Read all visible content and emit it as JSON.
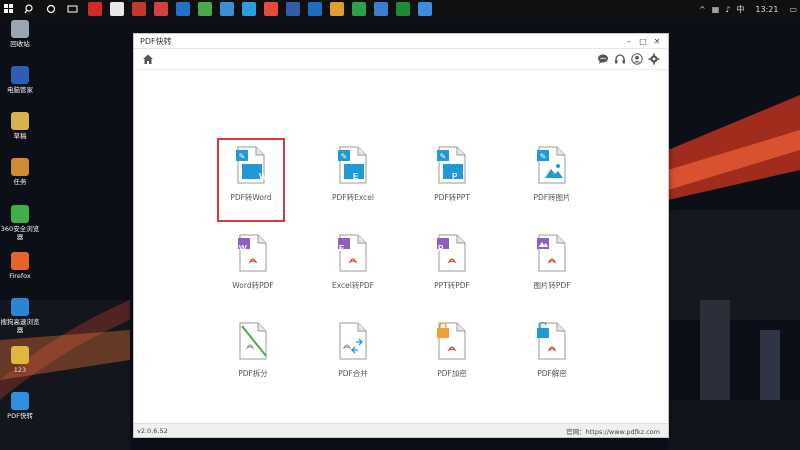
{
  "window": {
    "title": "PDF快转",
    "version": "v2.0.6.52",
    "site_label": "官网：",
    "site_url": "https://www.pdfkz.com"
  },
  "taskbar": {
    "time": "13:21",
    "ime": "中"
  },
  "desktop_icons": [
    {
      "label": "回收站",
      "icon": "recycle-bin-icon",
      "color": "#9aa6b2"
    },
    {
      "label": "电脑管家",
      "icon": "pc-manager-icon",
      "color": "#2b5fb3"
    },
    {
      "label": "草稿",
      "icon": "draft-icon",
      "color": "#d9b24a"
    },
    {
      "label": "任务",
      "icon": "task-icon",
      "color": "#d08a30"
    },
    {
      "label": "360安全浏览器",
      "icon": "360-browser-icon",
      "color": "#3fae49"
    },
    {
      "label": "Firefox",
      "icon": "firefox-icon",
      "color": "#e8622b"
    },
    {
      "label": "搜狗高速浏览器",
      "icon": "sogou-browser-icon",
      "color": "#2a85d6"
    },
    {
      "label": "123",
      "icon": "folder-icon",
      "color": "#e0b640"
    },
    {
      "label": "PDF快转",
      "icon": "pdf-converter-icon",
      "color": "#2f8fe0"
    }
  ],
  "tiles": [
    {
      "label": "PDF转Word",
      "badge": "W",
      "type": "pdf-to",
      "accent": "#1f9ad6",
      "selected": true
    },
    {
      "label": "PDF转Excel",
      "badge": "E",
      "type": "pdf-to",
      "accent": "#1f9ad6"
    },
    {
      "label": "PDF转PPT",
      "badge": "P",
      "type": "pdf-to",
      "accent": "#1f9ad6"
    },
    {
      "label": "PDF转图片",
      "badge": "",
      "type": "pdf-to-image",
      "accent": "#1f9ad6"
    },
    {
      "label": "Word转PDF",
      "badge": "W",
      "type": "to-pdf",
      "accent": "#8e5fbf"
    },
    {
      "label": "Excel转PDF",
      "badge": "E",
      "type": "to-pdf",
      "accent": "#8e5fbf"
    },
    {
      "label": "PPT转PDF",
      "badge": "P",
      "type": "to-pdf",
      "accent": "#8e5fbf"
    },
    {
      "label": "图片转PDF",
      "badge": "",
      "type": "image-to-pdf",
      "accent": "#8e5fbf"
    },
    {
      "label": "PDF拆分",
      "badge": "",
      "type": "split",
      "accent": "#5aa35a"
    },
    {
      "label": "PDF合并",
      "badge": "",
      "type": "merge",
      "accent": "#1f9ad6"
    },
    {
      "label": "PDF加密",
      "badge": "",
      "type": "encrypt",
      "accent": "#f0a030"
    },
    {
      "label": "PDF解密",
      "badge": "",
      "type": "decrypt",
      "accent": "#1f9ad6"
    }
  ],
  "colors": {
    "selection": "#d9363e",
    "pdf_red": "#d24b3e"
  }
}
